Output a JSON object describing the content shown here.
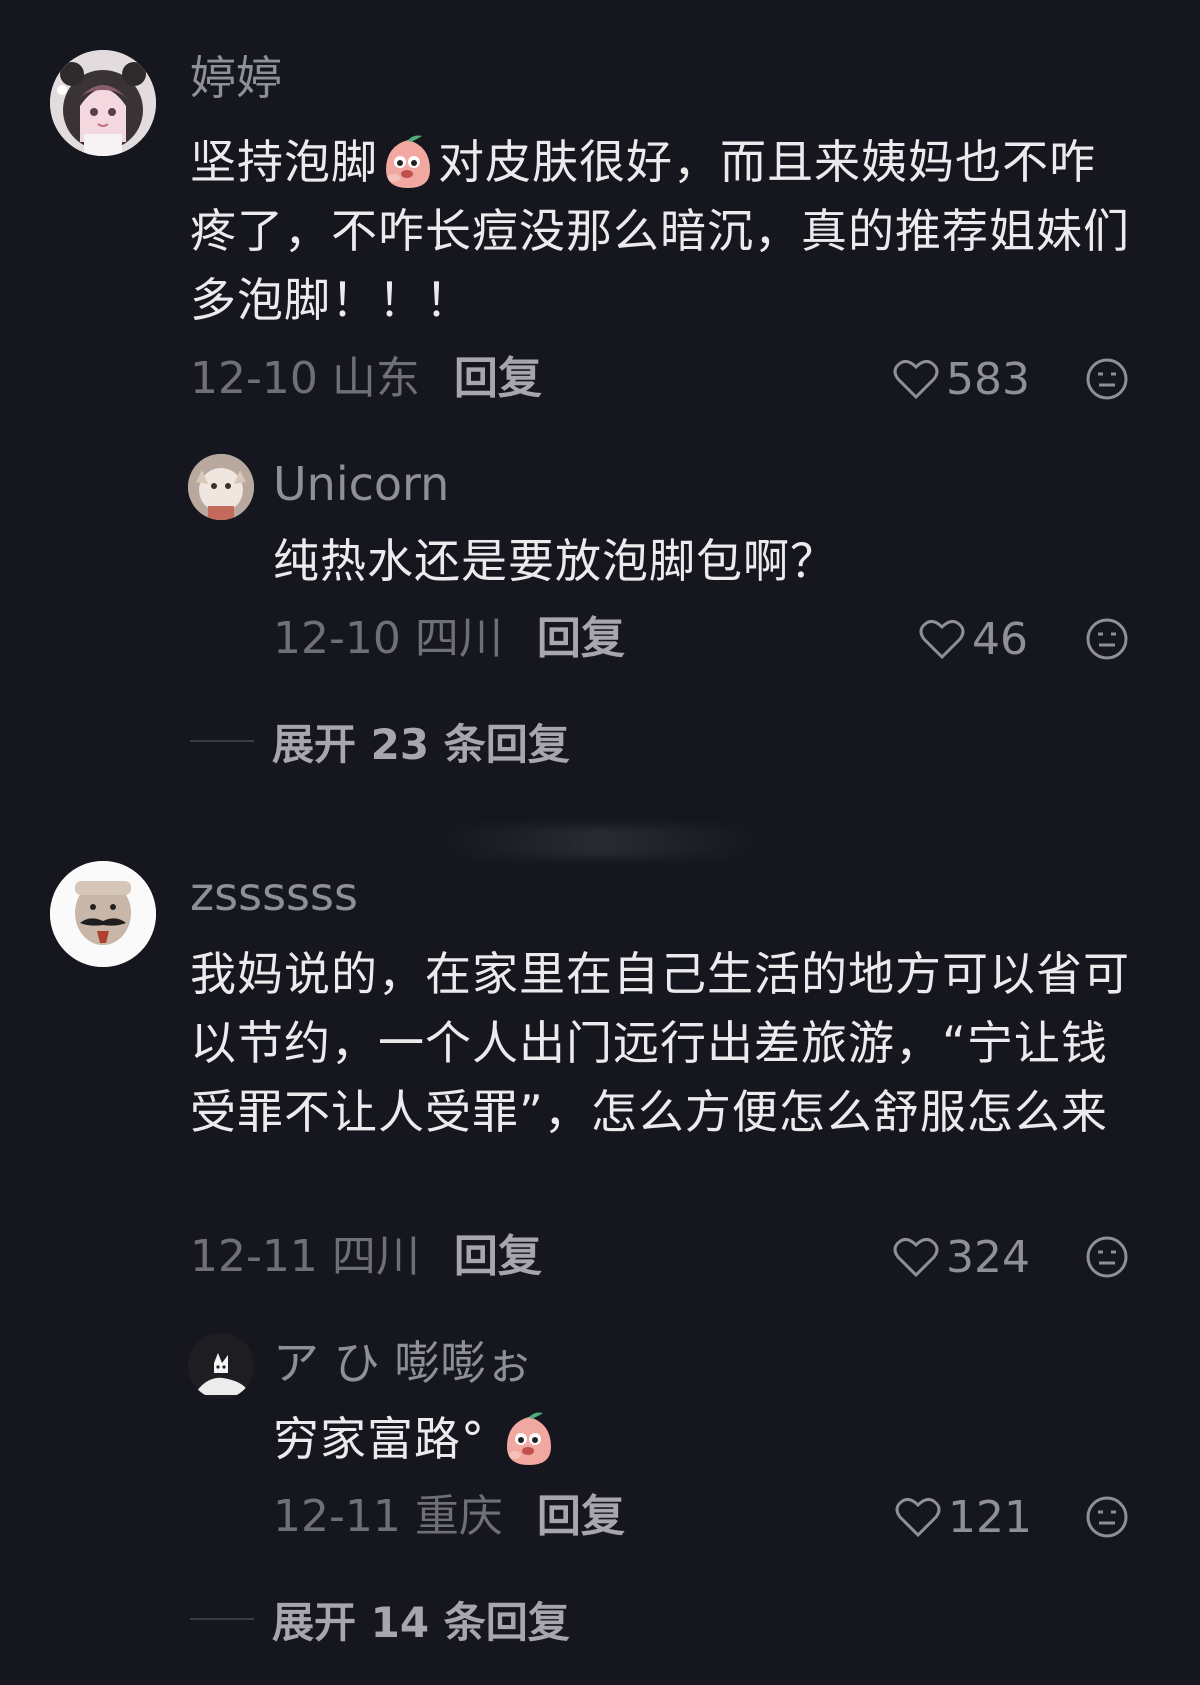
{
  "comments": [
    {
      "username": "婷婷",
      "text_before_sticker": "坚持泡脚",
      "text_after_sticker": "对皮肤很好，而且来姨妈也不咋疼了，不咋长痘没那么暗沉，真的推荐姐妹们多泡脚！！！",
      "date": "12-10",
      "location": "山东",
      "reply_label": "回复",
      "likes": "583",
      "avatar_icon": "anime-girl-panda-hood-avatar",
      "replies": [
        {
          "username": "Unicorn",
          "text": "纯热水还是要放泡脚包啊？",
          "date": "12-10",
          "location": "四川",
          "reply_label": "回复",
          "likes": "46",
          "avatar_icon": "cat-photo-avatar"
        }
      ],
      "expand_label": "展开 23 条回复"
    },
    {
      "username": "zssssss",
      "text": "我妈说的，在家里在自己生活的地方可以省可以节约，一个人出门远行出差旅游，“宁让钱受罪不让人受罪”，怎么方便怎么舒服怎么来",
      "date": "12-11",
      "location": "四川",
      "reply_label": "回复",
      "likes": "324",
      "avatar_icon": "mustache-face-avatar",
      "replies": [
        {
          "username": "ア ひ 嘭嘭ぉ",
          "text": "穷家富路°",
          "date": "12-11",
          "location": "重庆",
          "reply_label": "回复",
          "likes": "121",
          "avatar_icon": "drawn-cat-avatar"
        }
      ],
      "expand_label": "展开 14 条回复"
    }
  ],
  "icons": {
    "like": "heart-outline-icon",
    "emoji": "smiley-face-icon",
    "sticker": "peach-sticker-icon"
  },
  "colors": {
    "background": "#16161e",
    "text": "#ebebed",
    "muted": "#6f6f76",
    "username": "#8f8f96"
  }
}
